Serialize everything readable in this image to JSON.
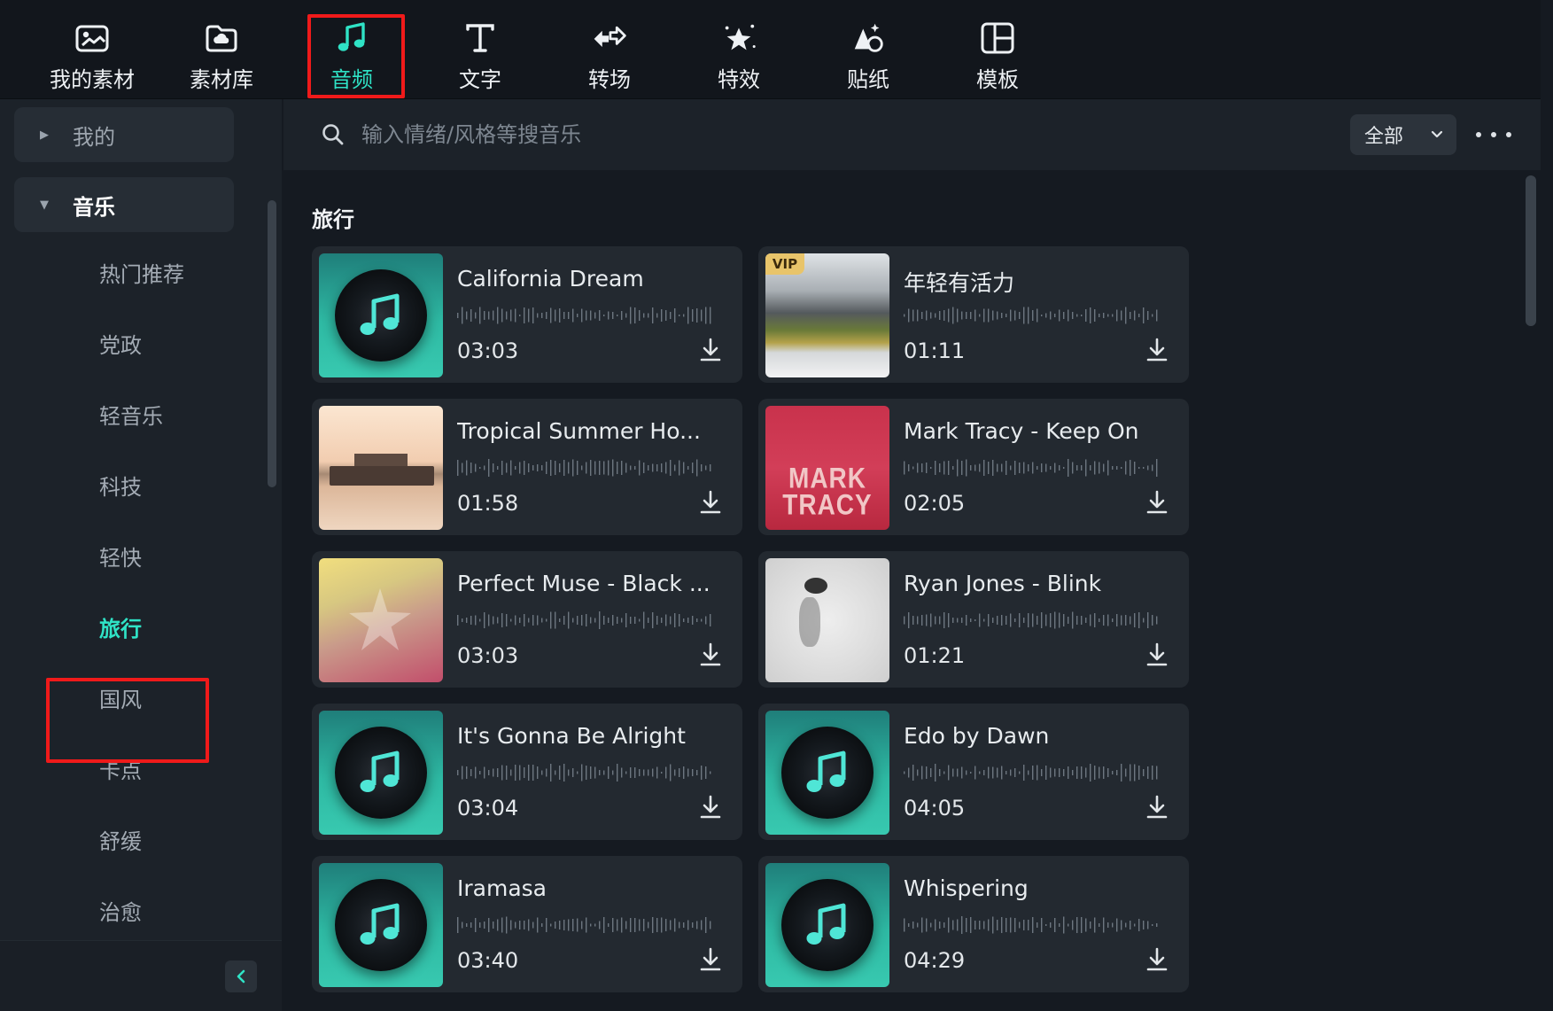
{
  "toolbar": {
    "items": [
      {
        "label": "我的素材",
        "icon": "image-icon"
      },
      {
        "label": "素材库",
        "icon": "cloud-folder-icon"
      },
      {
        "label": "音频",
        "icon": "music-note-icon"
      },
      {
        "label": "文字",
        "icon": "text-icon"
      },
      {
        "label": "转场",
        "icon": "transition-icon"
      },
      {
        "label": "特效",
        "icon": "effects-star-icon"
      },
      {
        "label": "贴纸",
        "icon": "sticker-icon"
      },
      {
        "label": "模板",
        "icon": "template-icon"
      }
    ],
    "active_index": 2
  },
  "sidebar": {
    "groups": [
      {
        "label": "我的",
        "expanded": false
      },
      {
        "label": "音乐",
        "expanded": true
      }
    ],
    "items": [
      "热门推荐",
      "党政",
      "轻音乐",
      "科技",
      "轻快",
      "旅行",
      "国风",
      "卡点",
      "舒缓",
      "治愈"
    ],
    "active_item": "旅行"
  },
  "search": {
    "placeholder": "输入情绪/风格等搜音乐",
    "filter_value": "全部"
  },
  "section": {
    "title": "旅行"
  },
  "tracks": [
    {
      "title": "California Dream",
      "duration": "03:03",
      "vip": false,
      "cover": "vinyl"
    },
    {
      "title": "年轻有活力",
      "duration": "01:11",
      "vip": true,
      "vip_label": "VIP",
      "cover": "mountain-lake"
    },
    {
      "title": "Tropical Summer Ho...",
      "duration": "01:58",
      "vip": false,
      "cover": "pier-sunset"
    },
    {
      "title": "Mark Tracy - Keep On",
      "duration": "02:05",
      "vip": false,
      "cover": "mark-tracy-red",
      "cover_text": [
        "MARK",
        "TRACY"
      ]
    },
    {
      "title": "Perfect Muse - Black ...",
      "duration": "03:03",
      "vip": false,
      "cover": "pastel-star"
    },
    {
      "title": "Ryan Jones - Blink",
      "duration": "01:21",
      "vip": false,
      "cover": "gray-portrait"
    },
    {
      "title": "It's Gonna Be Alright",
      "duration": "03:04",
      "vip": false,
      "cover": "vinyl"
    },
    {
      "title": "Edo by Dawn",
      "duration": "04:05",
      "vip": false,
      "cover": "vinyl"
    },
    {
      "title": "Iramasa",
      "duration": "03:40",
      "vip": false,
      "cover": "vinyl"
    },
    {
      "title": "Whispering",
      "duration": "04:29",
      "vip": false,
      "cover": "vinyl"
    }
  ],
  "colors": {
    "accent": "#2fe3c6",
    "highlight_box": "#f01a1a",
    "background": "#151a21",
    "card": "#232930",
    "vip_badge": "#e8c46a"
  }
}
